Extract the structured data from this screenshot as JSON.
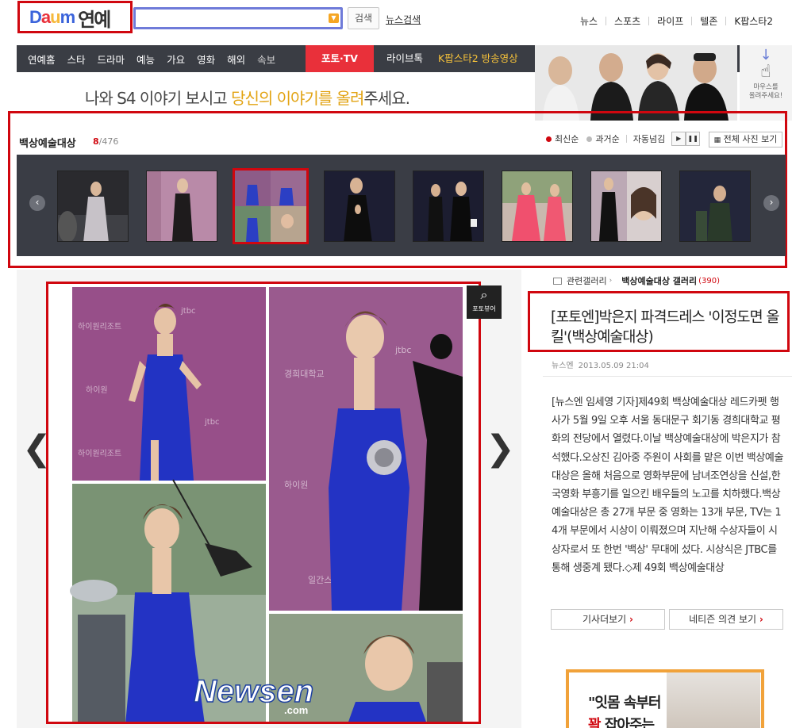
{
  "header": {
    "logo_text": "Daum",
    "logo_section": "연예",
    "search_value": "",
    "search_button": "검색",
    "news_search": "뉴스검색",
    "top_links": [
      "뉴스",
      "스포츠",
      "라이프",
      "텔존",
      "K팝스타2"
    ]
  },
  "nav": {
    "items": [
      "연예홈",
      "스타",
      "드라마",
      "예능",
      "가요",
      "영화",
      "해외",
      "속보"
    ],
    "active": "포토·TV",
    "live": "라이브톡",
    "kpop": "K팝스타2 방송영상"
  },
  "banner": {
    "text_prefix": "나와 S4 이야기 보시고 ",
    "text_highlight": "당신의 이야기를 올려",
    "text_suffix": "주세요.",
    "mouse_hint": "마우스를\n올려주세요!"
  },
  "gallery": {
    "title": "백상예술대상",
    "current": "8",
    "total": "/476",
    "sort_latest": "최신순",
    "sort_past": "과거순",
    "autoplay": "자동넘김",
    "all_photos": "전체 사진 보기",
    "selected_index": 2
  },
  "article": {
    "related_label": "관련갤러리",
    "related_gallery": "백상예술대상 갤러리",
    "related_count": "(390)",
    "headline": "[포토엔]박은지 파격드레스 '이정도면 올킬'(백상예술대상)",
    "source": "뉴스엔",
    "date": "2013.05.09 21:04",
    "body": "[뉴스엔 임세영 기자]제49회 백상예술대상 레드카펫 행사가 5월 9일 오후 서울 동대문구 회기동 경희대학교 평화의 전당에서 열렸다.이날 백상예술대상에 박은지가 참석했다.오상진 김아중 주원이 사회를 맡은 이번 백상예술대상은 올해 처음으로 영화부문에 남녀조연상을 신설,한국영화 부흥기를 일으킨 배우들의 노고를 치하했다.백상예술대상은 총 27개 부문 중 영화는 13개 부문, TV는 14개 부문에서 시상이 이뤄졌으며 지난해 수상자들이 시상자로서 또 한번 '백상' 무대에 섰다. 시상식은 JTBC를 통해 생중계 됐다.◇제 49회 백상예술대상",
    "more_button": "기사더보기",
    "opinion_button": "네티즌 의견 보기"
  },
  "viewer_label": "포토뷰어",
  "watermark": "Newsen",
  "watermark_sub": ".com",
  "ad": {
    "line1": "\"잇몸 속부터",
    "line2_red": "꽉",
    "line2": " 잡아주는"
  }
}
